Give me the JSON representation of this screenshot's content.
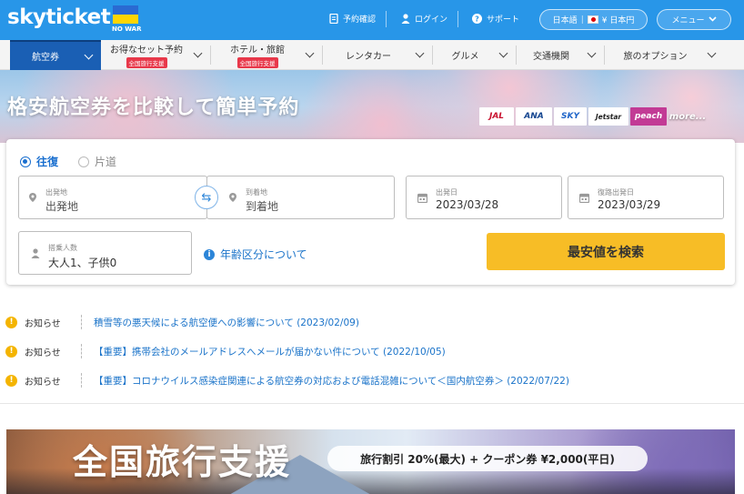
{
  "header": {
    "logo": "skyticket",
    "no_war": "NO WAR",
    "links": [
      {
        "label": "予約確認",
        "icon": "document-icon"
      },
      {
        "label": "ログイン",
        "icon": "user-icon"
      },
      {
        "label": "サポート",
        "icon": "help-icon"
      }
    ],
    "locale": {
      "language": "日本語",
      "currency": "¥ 日本円"
    },
    "menu_label": "メニュー",
    "colors": {
      "bar": "#2896e8",
      "flag_blue": "#2a6ad2",
      "flag_yellow": "#ffd500"
    }
  },
  "nav": {
    "tabs": [
      {
        "label": "航空券",
        "active": true
      },
      {
        "label": "お得なセット予約",
        "badge": "全国旅行支援"
      },
      {
        "label": "ホテル・旅館",
        "badge": "全国旅行支援"
      },
      {
        "label": "レンタカー"
      },
      {
        "label": "グルメ"
      },
      {
        "label": "交通機関"
      },
      {
        "label": "旅のオプション"
      }
    ]
  },
  "hero": {
    "title": "格安航空券を比較して簡単予約",
    "airlines": [
      "JAL",
      "ANA",
      "SKY",
      "Jetstar",
      "peach"
    ],
    "more": "more..."
  },
  "search": {
    "trip_types": [
      {
        "label": "往復",
        "selected": true
      },
      {
        "label": "片道",
        "selected": false
      }
    ],
    "origin": {
      "label": "出発地",
      "placeholder": "出発地"
    },
    "destination": {
      "label": "到着地",
      "placeholder": "到着地"
    },
    "departure_date": {
      "label": "出発日",
      "value": "2023/03/28"
    },
    "return_date": {
      "label": "復路出発日",
      "value": "2023/03/29"
    },
    "passengers": {
      "label": "搭乗人数",
      "value": "大人1、子供0"
    },
    "age_info": "年齢区分について",
    "submit": "最安値を検索",
    "accent": "#f7bd26"
  },
  "notices": [
    {
      "category": "お知らせ",
      "text": "積雪等の悪天候による航空便への影響について (2023/02/09)"
    },
    {
      "category": "お知らせ",
      "text": "【重要】携帯会社のメールアドレスへメールが届かない件について (2022/10/05)"
    },
    {
      "category": "お知らせ",
      "text": "【重要】コロナウイルス感染症関連による航空券の対応および電話混雑について＜国内航空券＞ (2022/07/22)"
    }
  ],
  "banner": {
    "title": "全国旅行支援",
    "pill": "旅行割引 20%(最大) + クーポン券 ¥2,000(平日)"
  }
}
